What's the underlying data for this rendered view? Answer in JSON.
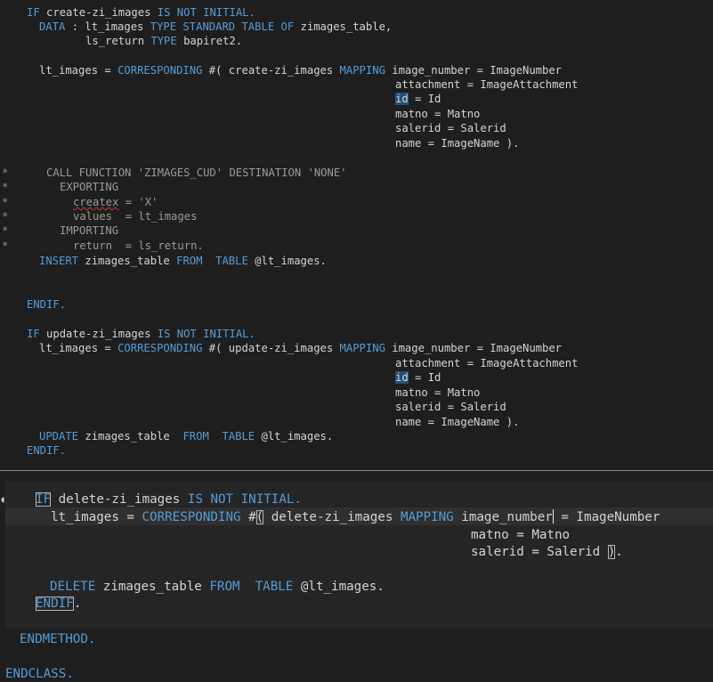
{
  "editor": {
    "language": "ABAP",
    "comment_marker": "*",
    "upper_lines": [
      [
        "kw:IF ",
        "tx:create-zi_images ",
        "kw:IS NOT INITIAL."
      ],
      [
        "kw:DATA ",
        "tx:: lt_images ",
        "kw:TYPE STANDARD TABLE OF ",
        "tx:zimages_table,"
      ],
      [
        "tx:ls_return ",
        "kw:TYPE ",
        "tx:bapiret2."
      ],
      [
        "tx:lt_images = ",
        "kw:CORRESPONDING ",
        "tx:#( create-zi_images ",
        "kw:MAPPING ",
        "tx:image_number = ImageNumber"
      ],
      [
        "tx:attachment = ImageAttachment"
      ],
      [
        "sel:id",
        "tx: = Id"
      ],
      [
        "tx:matno = Matno"
      ],
      [
        "tx:salerid = Salerid"
      ],
      [
        "tx:name = ImageName )."
      ],
      [
        "cm:CALL FUNCTION 'ZIMAGES_CUD' DESTINATION 'NONE'"
      ],
      [
        "cm:EXPORTING"
      ],
      [
        "sq:createx",
        "cm: = 'X'"
      ],
      [
        "cm:values  = lt_images"
      ],
      [
        "cm:IMPORTING"
      ],
      [
        "cm:return  = ls_return."
      ],
      [
        "kw:INSERT ",
        "tx:zimages_table ",
        "kw:FROM  TABLE ",
        "tx:@lt_images."
      ],
      [
        "kw:ENDIF."
      ],
      [
        "kw:IF ",
        "tx:update-zi_images ",
        "kw:IS NOT INITIAL."
      ],
      [
        "tx:lt_images = ",
        "kw:CORRESPONDING ",
        "tx:#( update-zi_images ",
        "kw:MAPPING ",
        "tx:image_number = ImageNumber"
      ],
      [
        "tx:attachment = ImageAttachment"
      ],
      [
        "sel:id",
        "tx: = Id"
      ],
      [
        "tx:matno = Matno"
      ],
      [
        "tx:salerid = Salerid"
      ],
      [
        "tx:name = ImageName )."
      ],
      [
        "kw:UPDATE ",
        "tx:zimages_table  ",
        "kw:FROM  TABLE ",
        "tx:@lt_images."
      ],
      [
        "kw:ENDIF."
      ]
    ],
    "focus_lines": [
      [
        "box:IF",
        "tx: delete-zi_images ",
        "kw:IS NOT INITIAL."
      ],
      [
        "tx:lt_images = ",
        "kw:CORRESPONDING ",
        "tx:#",
        "box:(",
        "tx: delete-zi_images ",
        "kw:MAPPING ",
        "tx:image_number",
        "cur:",
        "tx: = ImageNumber"
      ],
      [
        "tx:matno = Matno"
      ],
      [
        "tx:salerid = Salerid ",
        "box:)",
        "tx:."
      ],
      [
        "kw:DELETE ",
        "tx:zimages_table ",
        "kw:FROM  TABLE ",
        "tx:@lt_images."
      ],
      [
        "box:ENDIF",
        "tx:."
      ]
    ],
    "trailer_lines": [
      [
        "kw:ENDMETHOD."
      ],
      [
        "kw:ENDCLASS."
      ]
    ]
  }
}
